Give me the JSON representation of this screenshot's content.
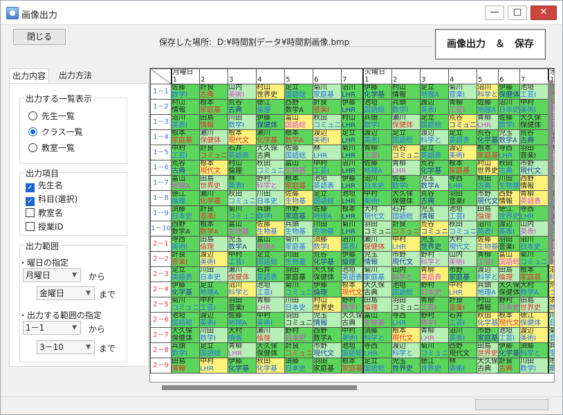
{
  "window": {
    "title": "画像出力",
    "minimize": "—",
    "maximize": "□",
    "close": "✕"
  },
  "toolbar": {
    "close_button": "閉じる",
    "saved_label": "保存した場所:",
    "saved_path": "D:¥時間割データ¥時間割画像.bmp",
    "output_button": "画像出力　＆　保存"
  },
  "tabs": [
    "出力内容",
    "出力方法"
  ],
  "display_group": {
    "title": "出力する一覧表示",
    "options": [
      "先生一覧",
      "クラス一覧",
      "教室一覧"
    ],
    "selected": "クラス一覧"
  },
  "items_group": {
    "title": "出力項目",
    "items": [
      {
        "label": "先生名",
        "checked": true
      },
      {
        "label": "科目(選択)",
        "checked": true
      },
      {
        "label": "教室名",
        "checked": false
      },
      {
        "label": "授業ID",
        "checked": false
      }
    ]
  },
  "range_group": {
    "title": "出力範囲",
    "day_label": "・曜日の指定",
    "day_from": "月曜日",
    "from_text": "から",
    "day_to": "金曜日",
    "to_text": "まで",
    "range_label": "・出力する範囲の指定",
    "range_from": "1－1",
    "range_to": "3－10"
  },
  "grid": {
    "days": [
      {
        "label": "月曜日",
        "span": 7
      },
      {
        "label": "火曜日",
        "span": 7
      },
      {
        "label": "水曜日",
        "span": 4
      }
    ],
    "periods": [
      "1",
      "2",
      "3",
      "4",
      "5",
      "6",
      "7",
      "1",
      "2",
      "3",
      "4",
      "5",
      "6",
      "7",
      "1",
      "2",
      "3",
      "4"
    ],
    "rows": [
      "1－1",
      "1－2",
      "1－3",
      "1－4",
      "1－5",
      "1－6",
      "1－7",
      "1－8",
      "1－9",
      "1－10",
      "2－1",
      "2－2",
      "2－3",
      "2－4",
      "2－5",
      "2－6",
      "2－7",
      "2－8",
      "2－9"
    ],
    "teachers": [
      "佐藤",
      "菊川",
      "野村",
      "荒谷",
      "渡辺",
      "瀬川",
      "寺西",
      "村山",
      "池垣",
      "大村",
      "富山",
      "市野",
      "川田",
      "計良",
      "沼川",
      "大久保",
      "林",
      "徳江",
      "青柳",
      "児玉",
      "足立",
      "根本",
      "兵頭",
      "羽田",
      "須藤",
      "秋田",
      "山内",
      "伊藤",
      "中村",
      "田島",
      "石井",
      "西野"
    ],
    "subjects": [
      "数学Ⅰ",
      "保健体",
      "国語総",
      "コミュニ",
      "LHR",
      "現代文",
      "科学と",
      "世界史",
      "生物基",
      "化学基",
      "英語表",
      "音楽Ⅰ",
      "美術Ⅰ",
      "数学A",
      "日本史",
      "倫理",
      "地理A",
      "古典",
      "工芸Ⅰ",
      "家庭基",
      "英表Ⅰ",
      "情報"
    ]
  },
  "colors": {
    "green": "#5bd55b",
    "lightgreen": "#b6f0b6",
    "yellow": "#fff27a",
    "period_blue": "#4870c8",
    "period_red": "#d83c44"
  }
}
